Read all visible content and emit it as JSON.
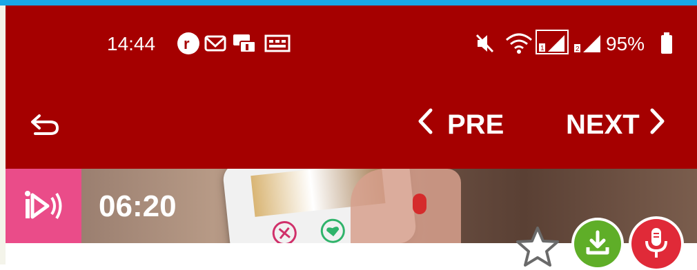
{
  "status_bar": {
    "time": "14:44",
    "battery": "95%",
    "icons": [
      "circle-r-icon",
      "gmail-icon",
      "chat-icon",
      "photo-icon",
      "mute-icon",
      "wifi-icon",
      "signal-sim1-icon",
      "signal-sim2-icon",
      "battery-icon"
    ]
  },
  "nav": {
    "back_icon": "return-icon",
    "prev_label": "PRE",
    "next_label": "NEXT"
  },
  "banner": {
    "duration": "06:20",
    "audio_icon": "audio-play-icon"
  },
  "actions": {
    "favorite_icon": "star-outline-icon",
    "download_icon": "download-icon",
    "record_icon": "microphone-icon"
  },
  "colors": {
    "header": "#a50000",
    "audio_tab": "#ea4c89",
    "download": "#5fae28",
    "record": "#e02a38"
  }
}
